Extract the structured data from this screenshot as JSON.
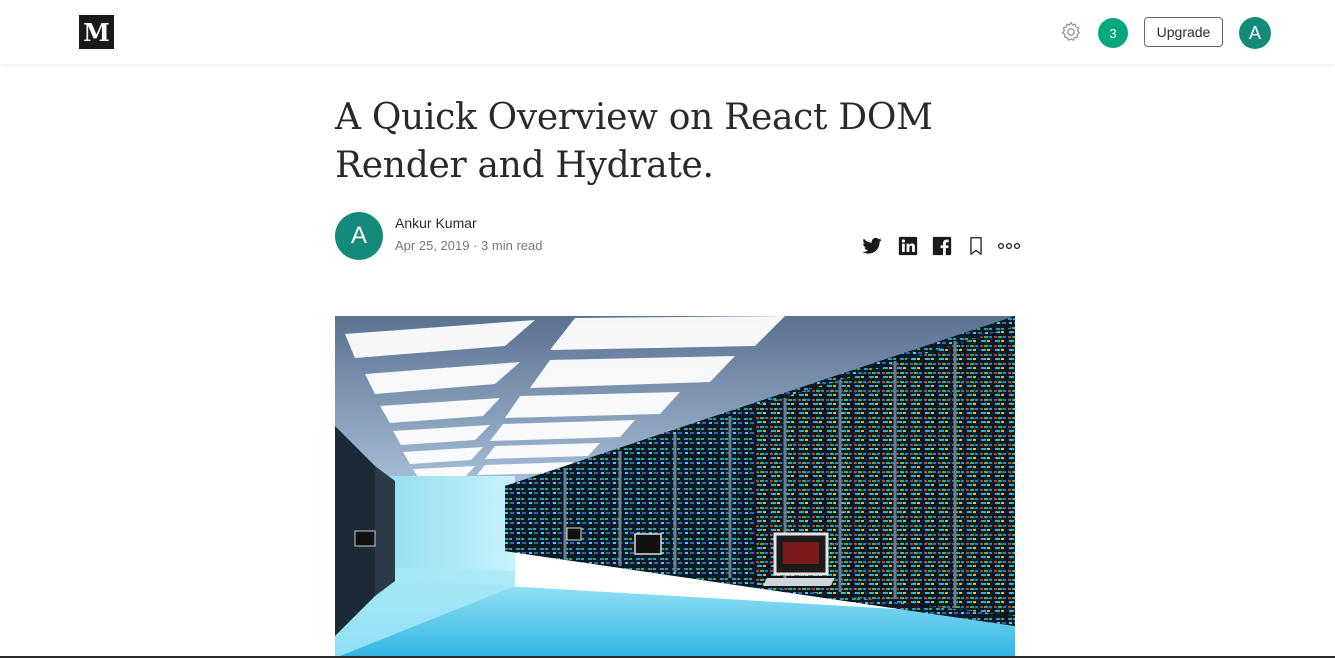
{
  "header": {
    "logo_text": "M",
    "notification_count": "3",
    "upgrade_label": "Upgrade",
    "user_initial": "A"
  },
  "article": {
    "title_line1": "A Quick Overview on React DOM",
    "title_line2": "Render and Hydrate.",
    "author_initial": "A",
    "author_name": "Ankur Kumar",
    "date": "Apr 25, 2019",
    "read_time": "3 min read",
    "meta_separator": "·"
  },
  "share_icons": [
    "twitter-icon",
    "linkedin-icon",
    "facebook-icon",
    "bookmark-icon",
    "more-icon"
  ],
  "colors": {
    "accent_green": "#03a87c",
    "avatar_teal": "#148a7a",
    "logo_black": "#1a1a1a"
  }
}
